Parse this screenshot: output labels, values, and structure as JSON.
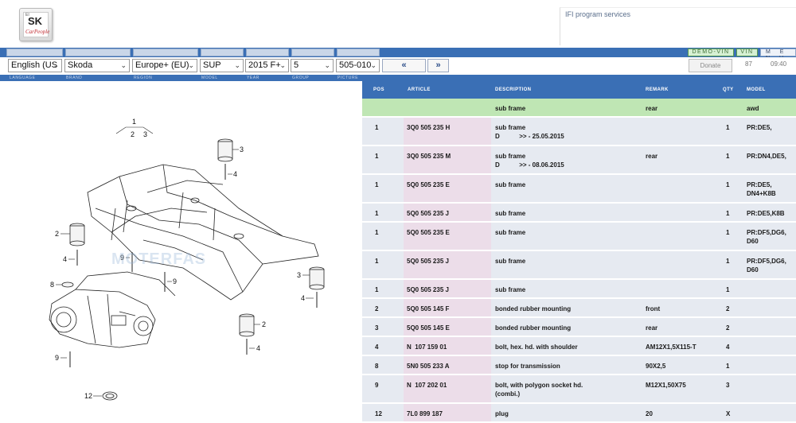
{
  "header": {
    "logo_small": "EI",
    "logo_main": "SK",
    "logo_script": "CarPeople",
    "ifi_text": "IFI program services"
  },
  "nav": {
    "demo_vin": "DEMO-VIN",
    "vin": "VIN",
    "menu": "M E N U"
  },
  "selectors": {
    "language": "English (US",
    "brand": "Skoda",
    "region": "Europe+ (EU)",
    "model": "SUP",
    "year": "2015  F+",
    "group": "5",
    "picture": "505-010",
    "prev": "«",
    "next": "»",
    "donate": "Donate",
    "counter": "87",
    "time": "09:40"
  },
  "labels": {
    "language": "LANGUAGE",
    "brand": "BRAND",
    "region": "REGION",
    "model": "MODEL",
    "year": "YEAR",
    "group": "GROUP",
    "picture": "PICTURE"
  },
  "diagram": {
    "watermark": "MOTERFAS",
    "callouts": [
      "1",
      "2",
      "3",
      "3",
      "4",
      "2",
      "4",
      "9",
      "9",
      "3",
      "4",
      "8",
      "2",
      "4",
      "9",
      "12"
    ]
  },
  "table": {
    "columns": {
      "pos": "POS",
      "article": "ARTICLE",
      "description": "DESCRIPTION",
      "remark": "REMARK",
      "qty": "QTY",
      "model": "MODEL"
    },
    "rows": [
      {
        "pos": "",
        "article": "",
        "description": "sub frame",
        "remark": "rear",
        "qty": "",
        "model": "awd",
        "highlight": true
      },
      {
        "pos": "1",
        "article": "3Q0 505 235 H",
        "description": "sub frame\nD           >> - 25.05.2015",
        "remark": "",
        "qty": "1",
        "model": "PR:DE5,"
      },
      {
        "pos": "1",
        "article": "3Q0 505 235 M",
        "description": "sub frame\nD           >> - 08.06.2015",
        "remark": "rear",
        "qty": "1",
        "model": "PR:DN4,DE5,"
      },
      {
        "pos": "1",
        "article": "5Q0 505 235 E",
        "description": "sub frame",
        "remark": "",
        "qty": "1",
        "model": "PR:DE5,\nDN4+K8B"
      },
      {
        "pos": "1",
        "article": "5Q0 505 235 J",
        "description": "sub frame",
        "remark": "",
        "qty": "1",
        "model": "PR:DE5,K8B"
      },
      {
        "pos": "1",
        "article": "5Q0 505 235 E",
        "description": "sub frame",
        "remark": "",
        "qty": "1",
        "model": "PR:DF5,DG6,\nD60"
      },
      {
        "pos": "1",
        "article": "5Q0 505 235 J",
        "description": "sub frame",
        "remark": "",
        "qty": "1",
        "model": "PR:DF5,DG6,\nD60"
      },
      {
        "pos": "1",
        "article": "5Q0 505 235 J",
        "description": "sub frame",
        "remark": "",
        "qty": "1",
        "model": ""
      },
      {
        "pos": "2",
        "article": "5Q0 505 145 F",
        "description": "bonded rubber mounting",
        "remark": "front",
        "qty": "2",
        "model": ""
      },
      {
        "pos": "3",
        "article": "5Q0 505 145 E",
        "description": "bonded rubber mounting",
        "remark": "rear",
        "qty": "2",
        "model": ""
      },
      {
        "pos": "4",
        "article": "N  107 159 01",
        "description": "bolt, hex. hd. with shoulder",
        "remark": "AM12X1,5X115-T",
        "qty": "4",
        "model": ""
      },
      {
        "pos": "8",
        "article": "5N0 505 233 A",
        "description": "stop for transmission",
        "remark": "90X2,5",
        "qty": "1",
        "model": ""
      },
      {
        "pos": "9",
        "article": "N  107 202 01",
        "description": "bolt, with polygon socket hd.\n(combi.)",
        "remark": "M12X1,50X75",
        "qty": "3",
        "model": ""
      },
      {
        "pos": "12",
        "article": "7L0 899 187",
        "description": "plug",
        "remark": "20",
        "qty": "X",
        "model": ""
      }
    ]
  }
}
